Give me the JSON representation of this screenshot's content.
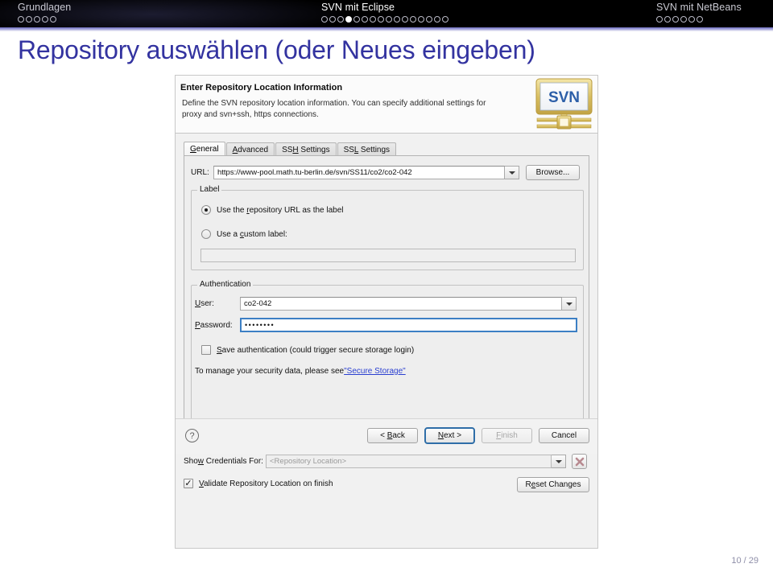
{
  "header": {
    "sections": [
      {
        "title": "Grundlagen",
        "dots": 5,
        "active_index": -1,
        "active": false
      },
      {
        "title": "SVN mit Eclipse",
        "dots": 16,
        "active_index": 3,
        "active": true
      },
      {
        "title": "SVN mit NetBeans",
        "dots": 6,
        "active_index": -1,
        "active": false
      }
    ]
  },
  "slide": {
    "title": "Repository auswählen (oder Neues eingeben)",
    "title_color": "#3333a0",
    "page_number": "10 / 29"
  },
  "dialog": {
    "head_title": "Enter Repository Location Information",
    "head_desc": "Define the SVN repository location information. You can specify additional settings for proxy and svn+ssh, https connections.",
    "logo_text": "SVN",
    "tabs": [
      {
        "label": "General",
        "mnemonic": "G",
        "selected": true
      },
      {
        "label": "Advanced",
        "mnemonic": "A",
        "selected": false
      },
      {
        "label": "SSH Settings",
        "mnemonic": "H",
        "selected": false
      },
      {
        "label": "SSL Settings",
        "mnemonic": "L",
        "selected": false
      }
    ],
    "url": {
      "label": "URL:",
      "value": "https://www-pool.math.tu-berlin.de/svn/SS11/co2/co2-042",
      "browse_label": "Browse..."
    },
    "label_group": {
      "title": "Label",
      "option_url": "Use the repository URL as the label",
      "option_custom": "Use a custom label:",
      "selected": "url",
      "custom_value": ""
    },
    "auth_group": {
      "title": "Authentication",
      "user_label": "User:",
      "user_value": "co2-042",
      "password_label": "Password:",
      "password_value": "••••••••",
      "save_auth_label": "Save authentication (could trigger secure storage login)",
      "save_auth_checked": false,
      "security_note_prefix": "To manage your security data, please see ",
      "security_note_link": "\"Secure Storage\""
    },
    "credentials": {
      "label": "Show Credentials For:",
      "value": "<Repository Location>",
      "delete_icon": "delete-x-icon"
    },
    "validate": {
      "label": "Validate Repository Location on finish",
      "checked": true,
      "check_glyph": "✓",
      "reset_label": "Reset Changes"
    },
    "buttons": {
      "help_icon": "?",
      "back": "< Back",
      "next": "Next >",
      "finish": "Finish",
      "cancel": "Cancel",
      "default_button": "next",
      "disabled_button": "finish"
    }
  }
}
